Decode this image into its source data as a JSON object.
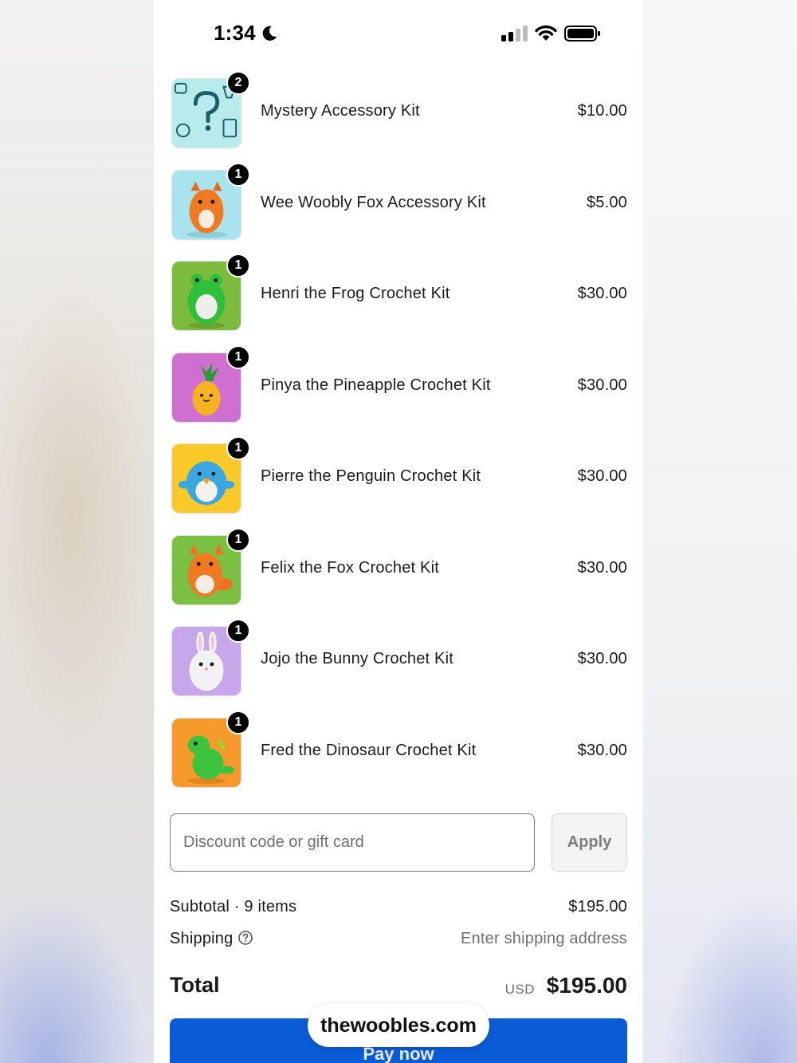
{
  "status_bar": {
    "time": "1:34",
    "icons": [
      "moon-icon",
      "cellular-signal-icon",
      "wifi-icon",
      "battery-icon"
    ]
  },
  "cart": {
    "items": [
      {
        "name": "Mystery Accessory Kit",
        "price": "$10.00",
        "quantity": "2",
        "thumb_color": "#b8ecec",
        "icon": "question-mark-pattern-icon"
      },
      {
        "name": "Wee Woobly Fox Accessory Kit",
        "price": "$5.00",
        "quantity": "1",
        "thumb_color": "#a9e4ee",
        "icon": "fox-plush-icon"
      },
      {
        "name": "Henri the Frog Crochet Kit",
        "price": "$30.00",
        "quantity": "1",
        "thumb_color": "#7dbb3e",
        "icon": "frog-plush-icon"
      },
      {
        "name": "Pinya the Pineapple Crochet Kit",
        "price": "$30.00",
        "quantity": "1",
        "thumb_color": "#cf6fcf",
        "icon": "pineapple-plush-icon"
      },
      {
        "name": "Pierre the Penguin Crochet Kit",
        "price": "$30.00",
        "quantity": "1",
        "thumb_color": "#f8c928",
        "icon": "penguin-plush-icon"
      },
      {
        "name": "Felix the Fox Crochet Kit",
        "price": "$30.00",
        "quantity": "1",
        "thumb_color": "#7cc043",
        "icon": "fox-plush-icon"
      },
      {
        "name": "Jojo the Bunny Crochet Kit",
        "price": "$30.00",
        "quantity": "1",
        "thumb_color": "#c6a8ea",
        "icon": "bunny-plush-icon"
      },
      {
        "name": "Fred the Dinosaur Crochet Kit",
        "price": "$30.00",
        "quantity": "1",
        "thumb_color": "#f79a2c",
        "icon": "dinosaur-plush-icon"
      }
    ]
  },
  "discount": {
    "placeholder": "Discount code or gift card",
    "apply_label": "Apply"
  },
  "summary": {
    "subtotal_label": "Subtotal · 9 items",
    "subtotal_value": "$195.00",
    "shipping_label": "Shipping",
    "shipping_value": "Enter shipping address",
    "total_label": "Total",
    "total_currency": "USD",
    "total_value": "$195.00"
  },
  "pay_button_label": "Pay now",
  "browser": {
    "url": "thewoobles.com"
  },
  "colors": {
    "pay_button": "#0a5bd6",
    "badge": "#000000"
  }
}
